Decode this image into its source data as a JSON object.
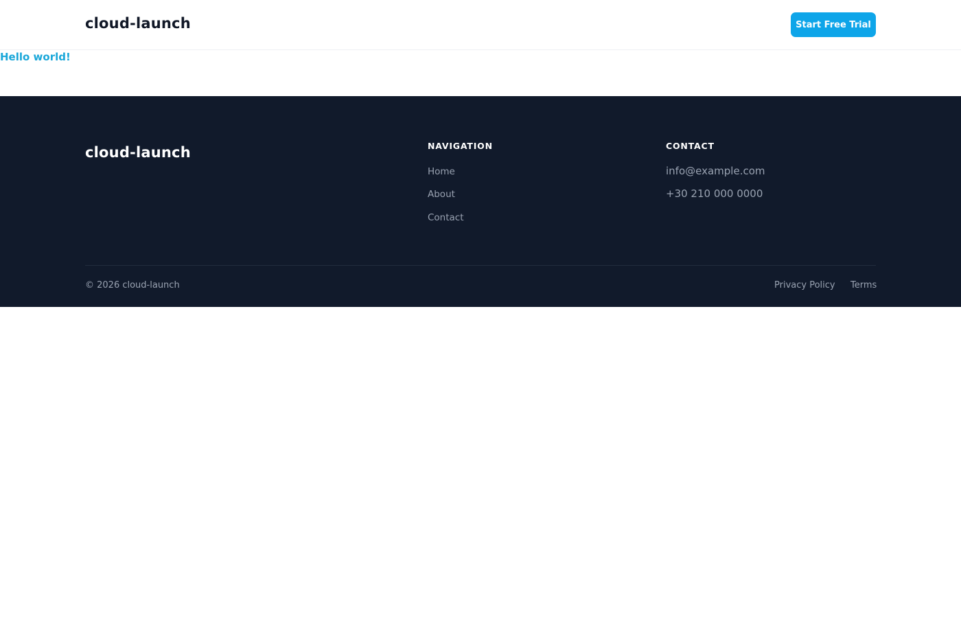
{
  "header": {
    "brand": "cloud-launch",
    "cta_label": "Start Free Trial"
  },
  "main": {
    "hello_text": "Hello world!"
  },
  "footer": {
    "brand": "cloud-launch",
    "navigation": {
      "title": "NAVIGATION",
      "links": [
        "Home",
        "About",
        "Contact"
      ]
    },
    "contact": {
      "title": "CONTACT",
      "email": "info@example.com",
      "phone": "+30 210 000 0000"
    },
    "copyright": "© 2026 cloud-launch",
    "legal_links": [
      "Privacy Policy",
      "Terms"
    ]
  },
  "colors": {
    "accent": "#0ea5e9",
    "footer_bg": "#111a2b",
    "muted_text": "#9aa3b2"
  }
}
